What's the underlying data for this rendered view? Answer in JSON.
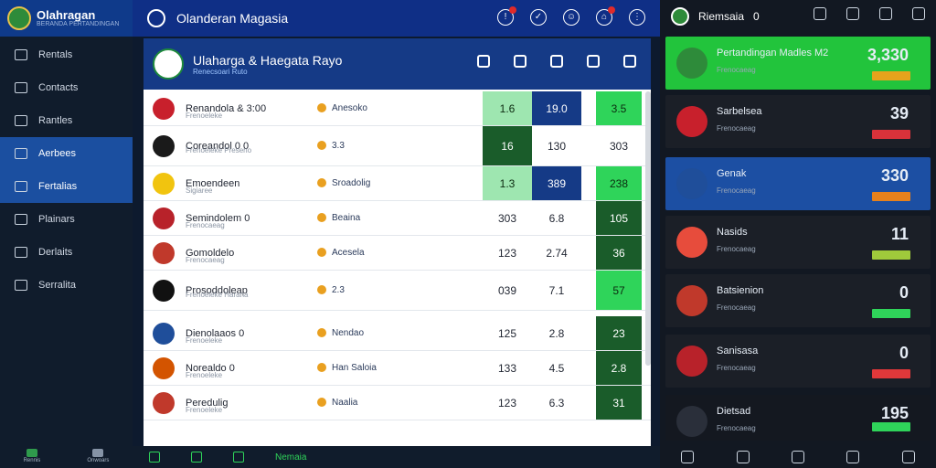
{
  "sidebar": {
    "brand_title": "Olahragan",
    "brand_sub": "BERANDA PERTANDINGAN",
    "items": [
      {
        "label": "Rentals"
      },
      {
        "label": "Contacts"
      },
      {
        "label": "Rantles"
      },
      {
        "label": "Aerbees"
      },
      {
        "label": "Fertalias"
      },
      {
        "label": "Plainars"
      },
      {
        "label": "Derlaits"
      },
      {
        "label": "Serralita"
      }
    ],
    "footer": [
      {
        "label": "Rennis"
      },
      {
        "label": "Onwoars"
      }
    ]
  },
  "topbar": {
    "title": "Olanderan Magasia"
  },
  "match": {
    "title": "Ulaharga & Haegata Rayo",
    "subtitle": "Renecsoari Ruto"
  },
  "rows": [
    {
      "team": "Renandola & 3:00",
      "sub": "Frenoeleke",
      "event": "Anesoko",
      "c1": "1.6",
      "c2": "19.0",
      "c3": "3.5",
      "c1class": "g-pale",
      "c2class": "b-dark",
      "c3class": "g-light",
      "tall": false
    },
    {
      "team": "Coreandol 0 0",
      "sub": "Frenoeleke Preseno",
      "event": "3.3",
      "c1": "16",
      "c2": "130",
      "c3": "303",
      "c1class": "g-dark",
      "c2class": "",
      "c3class": "",
      "tall": true
    },
    {
      "team": "Emoendeen",
      "sub": "Sigiaree",
      "event": "Sroadolig",
      "c1": "1.3",
      "c2": "389",
      "c3": "238",
      "c1class": "g-pale",
      "c2class": "b-dark",
      "c3class": "g-light",
      "tall": false
    },
    {
      "team": "Semindolem 0",
      "sub": "Frenocaeag",
      "event": "Beaina",
      "c1": "303",
      "c2": "6.8",
      "c3": "105",
      "c1class": "",
      "c2class": "",
      "c3class": "g-dark",
      "tall": false
    },
    {
      "team": "Gomoldelo",
      "sub": "Frenocaeag",
      "event": "Acesela",
      "c1": "123",
      "c2": "2.74",
      "c3": "36",
      "c1class": "",
      "c2class": "",
      "c3class": "g-dark",
      "tall": false
    },
    {
      "team": "Prosoddoleap",
      "sub": "Frenoeleke Harana",
      "event": "2.3",
      "c1": "039",
      "c2": "7.1",
      "c3": "57",
      "c1class": "",
      "c2class": "",
      "c3class": "g-light",
      "tall": true
    },
    {
      "team": "Dienolaaos 0",
      "sub": "Frenoeleke",
      "event": "Nendao",
      "c1": "125",
      "c2": "2.8",
      "c3": "23",
      "c1class": "",
      "c2class": "",
      "c3class": "g-dark",
      "tall": false,
      "gap": true
    },
    {
      "team": "Norealdo 0",
      "sub": "Frenoeleke",
      "event": "Han Saloia",
      "c1": "133",
      "c2": "4.5",
      "c3": "2.8",
      "c1class": "",
      "c2class": "",
      "c3class": "g-dark",
      "tall": false
    },
    {
      "team": "Peredulig",
      "sub": "Frenoeleke",
      "event": "Naalia",
      "c1": "123",
      "c2": "6.3",
      "c3": "31",
      "c1class": "",
      "c2class": "",
      "c3class": "g-dark",
      "tall": false
    }
  ],
  "bottombar": {
    "label": "Nemaia"
  },
  "right": {
    "title": "Riemsaia",
    "top_value": "0",
    "cards": [
      {
        "name": "Pertandingan Madles M2",
        "sub": "Frenocaeag",
        "value": "3,330",
        "bg": "#22c43c",
        "barcolor": "#e6a31c"
      },
      {
        "name": "Sarbelsea",
        "sub": "Frenocaeag",
        "value": "39",
        "bg": "#1b1f27",
        "barcolor": "#d8323a"
      },
      {
        "name": "Genak",
        "sub": "Frenocaeag",
        "value": "330",
        "bg": "#1c4fa3",
        "barcolor": "#e6811c"
      },
      {
        "name": "Nasids",
        "sub": "Frenocaeag",
        "value": "11",
        "bg": "#1b1f27",
        "barcolor": "#9fc93b"
      },
      {
        "name": "Batsienion",
        "sub": "Frenocaeag",
        "value": "0",
        "bg": "#1b1f27",
        "barcolor": "#2fd45a"
      },
      {
        "name": "Sanisasa",
        "sub": "Frenocaeag",
        "value": "0",
        "bg": "#1b1f27",
        "barcolor": "#e0383a"
      },
      {
        "name": "Dietsad",
        "sub": "Frenocaeag",
        "value": "195",
        "bg": "#141820",
        "barcolor": "#2fd45a"
      }
    ]
  }
}
